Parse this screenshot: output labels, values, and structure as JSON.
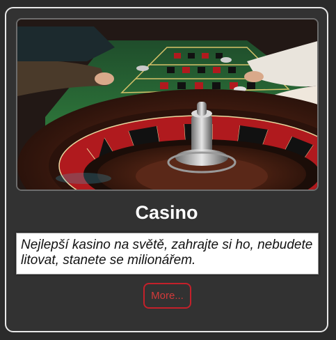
{
  "card": {
    "image": {
      "alt_subject": "roulette-table-photo"
    },
    "title": "Casino",
    "description": "Nejlepší kasino na světě, zahrajte si ho, nebudete litovat, stanete se milionářem.",
    "more_label": "More..."
  },
  "colors": {
    "page_background": "#2b2b2b",
    "card_background": "#323232",
    "card_border": "#e8e8e8",
    "button_accent": "#c4202a",
    "felt_green": "#2f6b3a",
    "wheel_red": "#b01a1e"
  }
}
